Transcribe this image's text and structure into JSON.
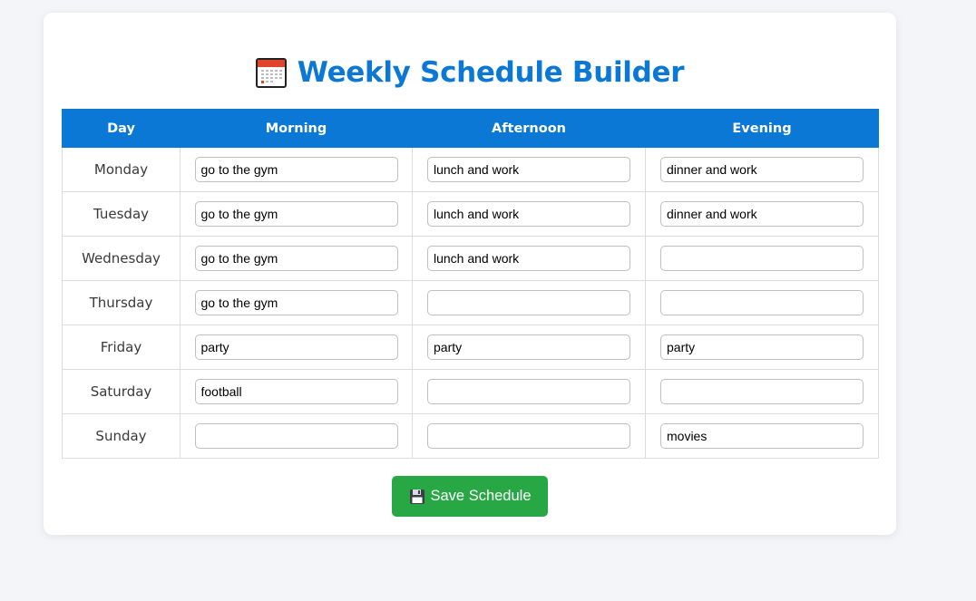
{
  "page": {
    "title": "Weekly Schedule Builder",
    "title_icon": "calendar-icon",
    "title_color": "#0b78d6"
  },
  "schedule": {
    "headers": [
      "Day",
      "Morning",
      "Afternoon",
      "Evening"
    ],
    "header_color": "#0b78d6",
    "rows": [
      {
        "day": "Monday",
        "morning": "go to the gym",
        "afternoon": "lunch and work",
        "evening": "dinner and work"
      },
      {
        "day": "Tuesday",
        "morning": "go to the gym",
        "afternoon": "lunch and work",
        "evening": "dinner and work"
      },
      {
        "day": "Wednesday",
        "morning": "go to the gym",
        "afternoon": "lunch and work",
        "evening": ""
      },
      {
        "day": "Thursday",
        "morning": "go to the gym",
        "afternoon": "",
        "evening": ""
      },
      {
        "day": "Friday",
        "morning": "party",
        "afternoon": "party",
        "evening": "party"
      },
      {
        "day": "Saturday",
        "morning": "football",
        "afternoon": "",
        "evening": ""
      },
      {
        "day": "Sunday",
        "morning": "",
        "afternoon": "",
        "evening": "movies"
      }
    ]
  },
  "actions": {
    "save_label": "Save Schedule",
    "save_icon": "floppy-disk-icon",
    "save_color": "#27a845"
  }
}
